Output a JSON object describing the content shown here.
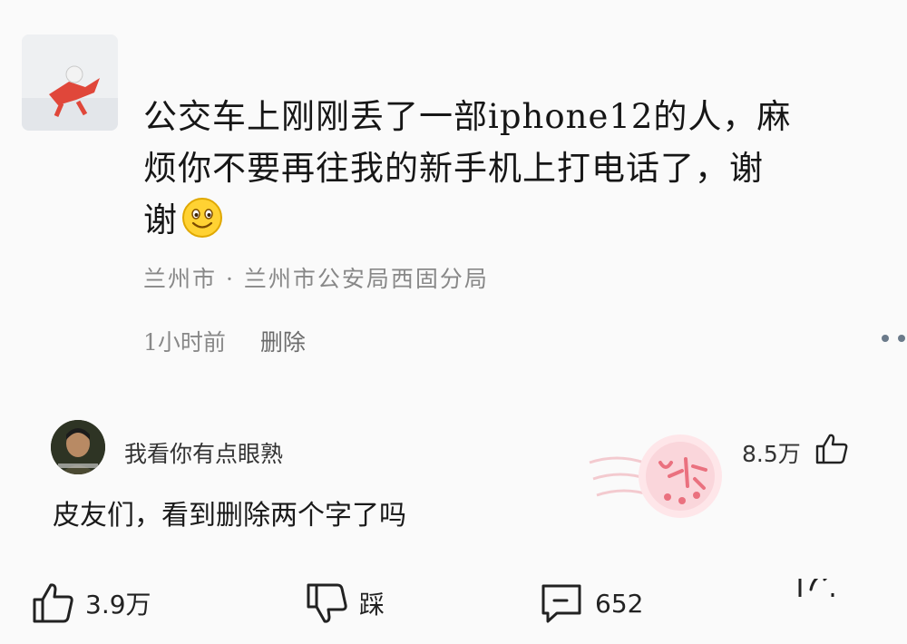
{
  "post": {
    "text_line1": "公交车上刚刚丢了一部iphone12的人，麻",
    "text_line2": "烦你不要再往我的新手机上打电话了，谢",
    "text_line3": "谢",
    "location": "兰州市 · 兰州市公安局西固分局",
    "time": "1小时前",
    "delete_label": "删除"
  },
  "comment": {
    "username": "我看你有点眼熟",
    "likes": "8.5万",
    "text": "皮友们，看到删除两个字了吗"
  },
  "actions": {
    "like_count": "3.9万",
    "dislike_label": "踩",
    "comment_count": "652"
  },
  "colors": {
    "background": "#fafafa",
    "text": "#161616",
    "meta_text": "#888888",
    "stamp": "#e85a6a"
  },
  "icons": {
    "like": "thumbs-up-icon",
    "dislike": "thumbs-down-icon",
    "comment": "comment-bubble-icon",
    "share": "share-icon",
    "more": "more-dots-icon",
    "emoji": "smiley-emoji"
  }
}
